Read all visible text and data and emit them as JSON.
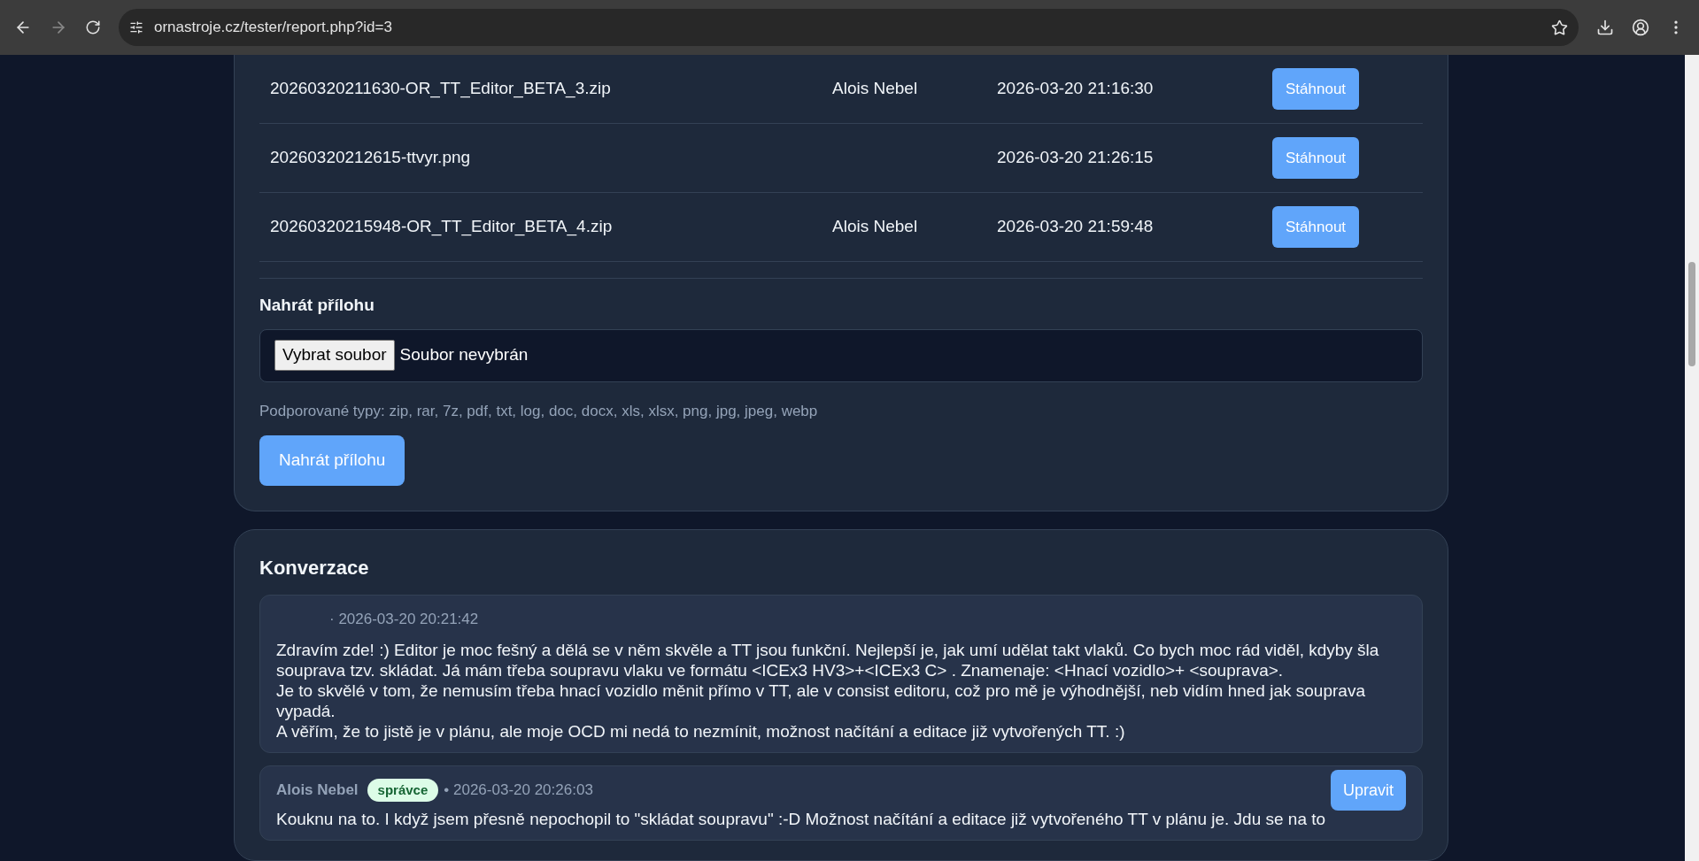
{
  "browser": {
    "url": "ornastroje.cz/tester/report.php?id=3"
  },
  "attachments": {
    "rows": [
      {
        "filename": "20260320211630-OR_TT_Editor_BETA_3.zip",
        "author": "Alois Nebel",
        "date": "2026-03-20 21:16:30",
        "action": "Stáhnout"
      },
      {
        "filename": "20260320212615-ttvyr.png",
        "date": "2026-03-20 21:26:15",
        "action": "Stáhnout"
      },
      {
        "filename": "20260320215948-OR_TT_Editor_BETA_4.zip",
        "author": "Alois Nebel",
        "date": "2026-03-20 21:59:48",
        "action": "Stáhnout"
      }
    ]
  },
  "upload": {
    "heading": "Nahrát přílohu",
    "choose_button": "Vybrat soubor",
    "file_status": "Soubor nevybrán",
    "supported": "Podporované typy: zip, rar, 7z, pdf, txt, log, doc, docx, xls, xlsx, png, jpg, jpeg, webp",
    "submit": "Nahrát přílohu"
  },
  "conversation": {
    "title": "Konverzace",
    "messages": [
      {
        "meta": "· 2026-03-20 20:21:42",
        "text": "Zdravím zde! :) Editor je moc fešný a dělá se v něm skvěle a TT jsou funkční. Nejlepší je, jak umí udělat takt vlaků. Co bych moc rád viděl, kdyby šla souprava tzv. skládat. Já mám třeba soupravu vlaku ve formátu <ICEx3 HV3>+<ICEx3 C> . Znamenaje: <Hnací vozidlo>+ <souprava>.\nJe to skvělé v tom, že nemusím třeba hnací vozidlo měnit přímo v TT, ale v consist editoru, což pro mě je výhodnější, neb vidím hned jak souprava vypadá.\nA věřím, že to jistě je v plánu, ale moje OCD mi nedá to nezmínit, možnost načítání a editace již vytvořených TT. :)"
      },
      {
        "author": "Alois Nebel",
        "role_badge": "správce",
        "meta": "• 2026-03-20 20:26:03",
        "edit_button": "Upravit",
        "text": "Kouknu na to. I když jsem přesně nepochopil to \"skládat soupravu\" :-D Možnost načítání a editace již vytvořeného TT v plánu je. Jdu se na to"
      }
    ]
  }
}
